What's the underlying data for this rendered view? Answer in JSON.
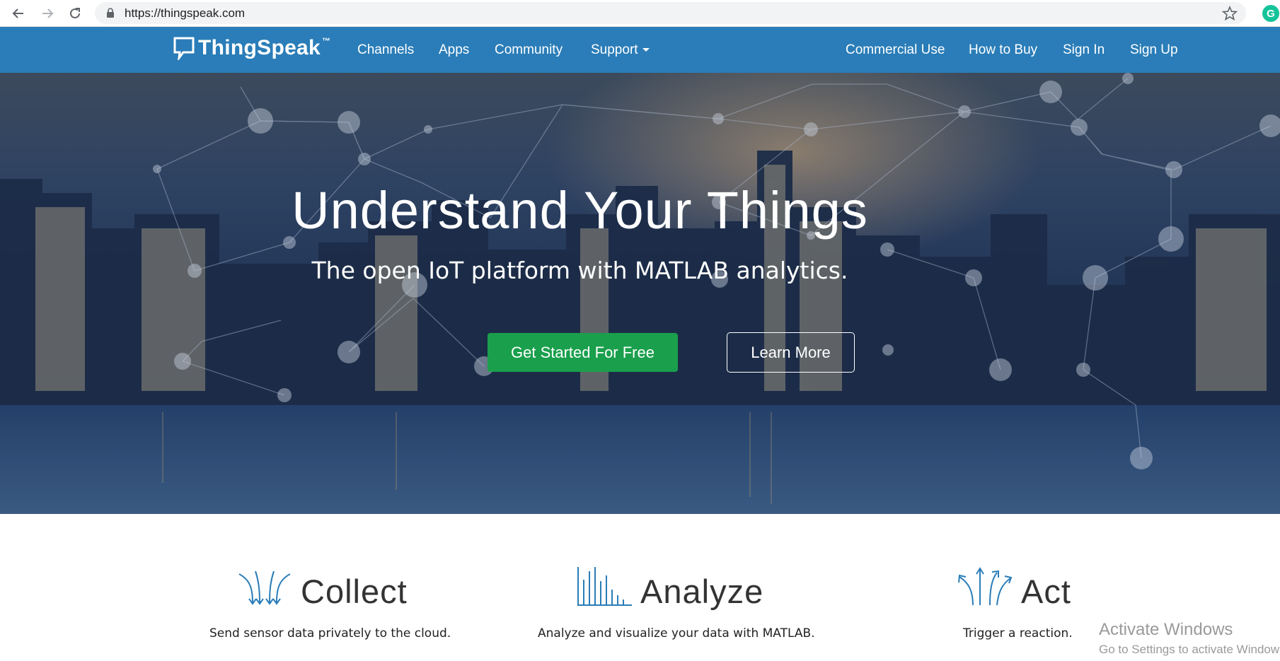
{
  "browser": {
    "url": "https://thingspeak.com",
    "extension_letter": "G",
    "icons": [
      "back-arrow-icon",
      "forward-arrow-icon",
      "reload-icon",
      "lock-icon",
      "star-icon"
    ]
  },
  "navbar": {
    "brand": "ThingSpeak",
    "brand_tm": "™",
    "left_links": [
      "Channels",
      "Apps",
      "Community",
      "Support"
    ],
    "right_links": [
      "Commercial Use",
      "How to Buy",
      "Sign In",
      "Sign Up"
    ],
    "color": "#2a7db8"
  },
  "hero": {
    "title": "Understand Your Things",
    "subtitle": "The open IoT platform with MATLAB analytics.",
    "primary_button": "Get Started For Free",
    "secondary_button": "Learn More",
    "primary_color": "#1a9f4c"
  },
  "features": [
    {
      "icon": "collect-arrows-icon",
      "title": "Collect",
      "description": "Send sensor data privately to the cloud."
    },
    {
      "icon": "analyze-bars-icon",
      "title": "Analyze",
      "description": "Analyze and visualize your data with MATLAB."
    },
    {
      "icon": "act-arrows-icon",
      "title": "Act",
      "description": "Trigger a reaction."
    }
  ],
  "watermark": {
    "title": "Activate Windows",
    "subtitle": "Go to Settings to activate Windows."
  }
}
